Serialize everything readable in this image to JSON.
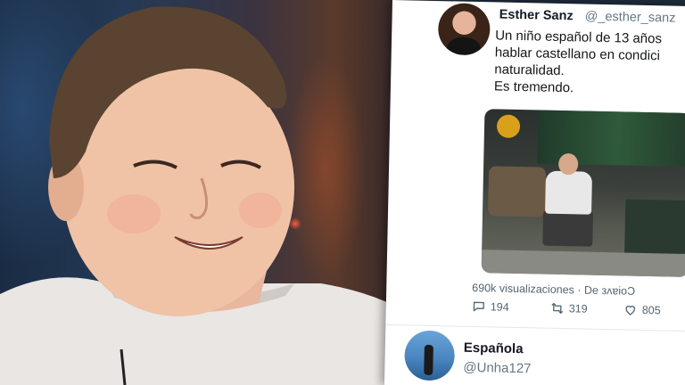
{
  "tweet": {
    "author_name": "Esther Sanz",
    "author_handle": "@_esther_sanz",
    "text_lines": [
      "Un niño español de 13 años",
      "hablar castellano en condici",
      "naturalidad.",
      "Es tremendo."
    ],
    "views": "690k visualizaciones · De зʌɐioƆ",
    "stats": {
      "replies": "194",
      "retweets": "319",
      "likes": "805"
    }
  },
  "reply": {
    "author_name": "Española",
    "author_handle": "@Unha127"
  },
  "icons": {
    "reply": "comment-icon",
    "retweet": "retweet-icon",
    "like": "heart-icon"
  },
  "colors": {
    "text_primary": "#14171a",
    "text_secondary": "#536471",
    "card_bg": "#ffffff"
  }
}
